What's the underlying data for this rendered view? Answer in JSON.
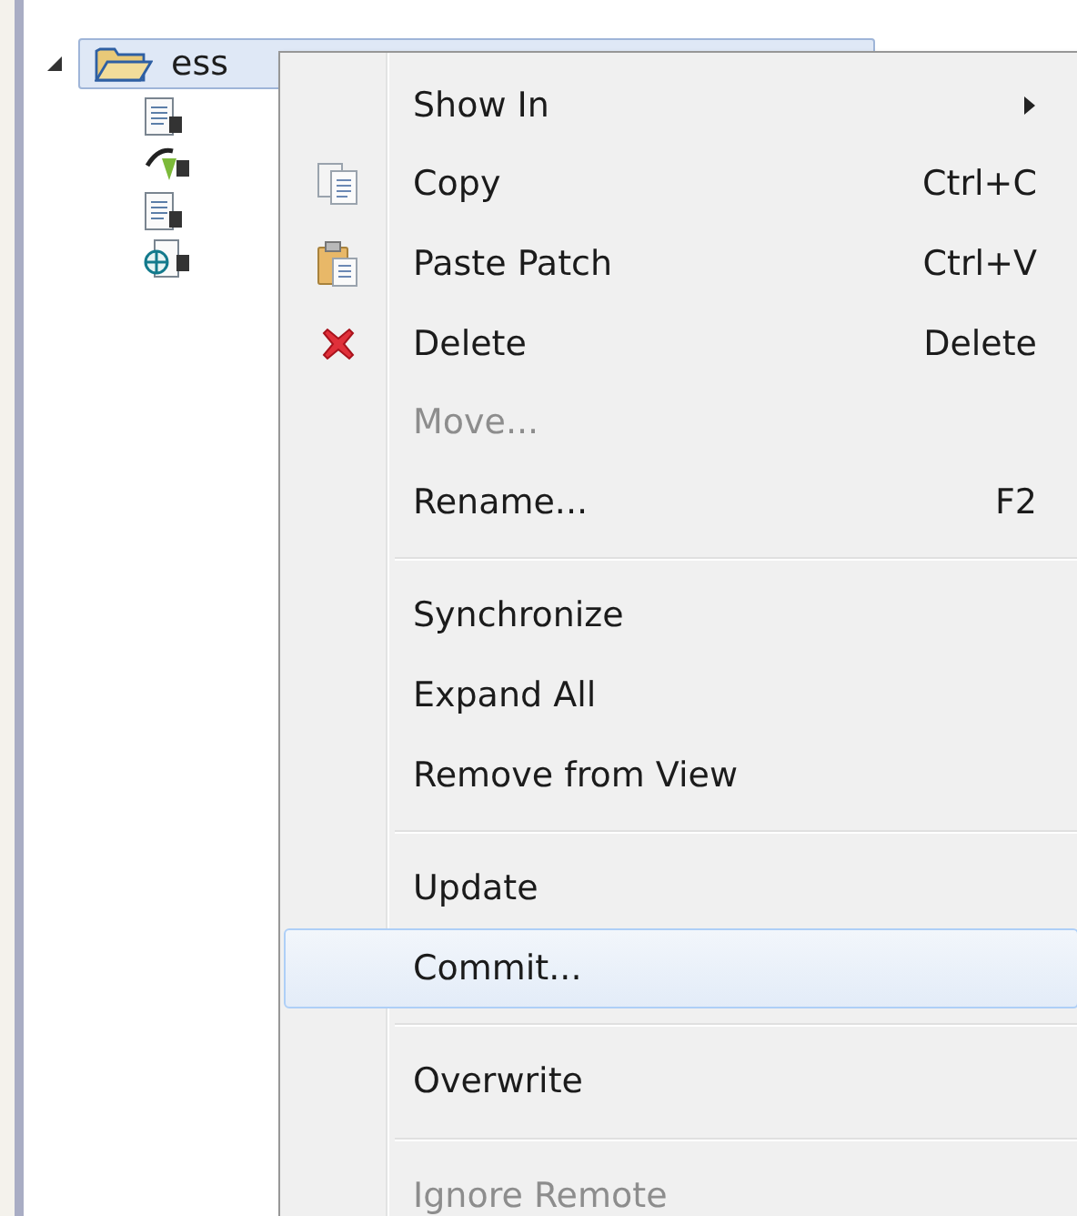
{
  "tree": {
    "root": {
      "label": "ess",
      "expanded": true,
      "selected": true,
      "children": [
        {
          "kind": "file"
        },
        {
          "kind": "sync"
        },
        {
          "kind": "file"
        },
        {
          "kind": "web"
        }
      ]
    }
  },
  "context_menu": {
    "items": [
      {
        "kind": "submenu",
        "label": "Show In",
        "disabled": false,
        "selected": false
      },
      {
        "kind": "copy",
        "label": "Copy",
        "shortcut": "Ctrl+C",
        "disabled": false,
        "selected": false
      },
      {
        "kind": "paste",
        "label": "Paste Patch",
        "shortcut": "Ctrl+V",
        "disabled": false,
        "selected": false
      },
      {
        "kind": "delete",
        "label": "Delete",
        "shortcut": "Delete",
        "disabled": false,
        "selected": false
      },
      {
        "kind": "item",
        "label": "Move...",
        "disabled": true,
        "selected": false
      },
      {
        "kind": "item",
        "label": "Rename...",
        "shortcut": "F2",
        "disabled": false,
        "selected": false
      },
      {
        "kind": "separator"
      },
      {
        "kind": "item",
        "label": "Synchronize",
        "disabled": false,
        "selected": false
      },
      {
        "kind": "item",
        "label": "Expand All",
        "disabled": false,
        "selected": false
      },
      {
        "kind": "item",
        "label": "Remove from View",
        "disabled": false,
        "selected": false
      },
      {
        "kind": "separator"
      },
      {
        "kind": "item",
        "label": "Update",
        "disabled": false,
        "selected": false
      },
      {
        "kind": "item",
        "label": "Commit...",
        "disabled": false,
        "selected": true
      },
      {
        "kind": "separator"
      },
      {
        "kind": "item",
        "label": "Overwrite",
        "disabled": false,
        "selected": false
      },
      {
        "kind": "separator"
      },
      {
        "kind": "item",
        "label": "Ignore Remote",
        "disabled": true,
        "selected": false
      }
    ]
  }
}
